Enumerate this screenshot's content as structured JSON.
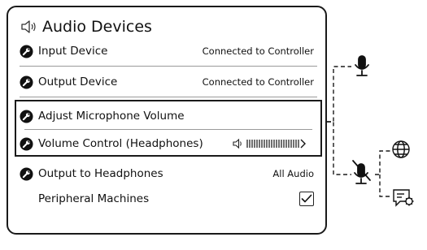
{
  "panel": {
    "title": "Audio Devices",
    "title_icon": "speaker-icon",
    "rows": [
      {
        "label": "Input Device",
        "value": "Connected to Controller",
        "icon": "wrench-icon"
      },
      {
        "label": "Output Device",
        "value": "Connected to Controller",
        "icon": "wrench-icon"
      },
      {
        "label": "Adjust Microphone Volume",
        "value": "",
        "icon": "wrench-icon"
      },
      {
        "label": "Volume Control (Headphones)",
        "value": "",
        "icon": "wrench-icon",
        "control": "volume-slider"
      },
      {
        "label": "Output to Headphones",
        "value": "All Audio",
        "icon": "wrench-icon"
      },
      {
        "label": "Peripheral Machines",
        "value": "",
        "checkbox_checked": true
      }
    ]
  },
  "side_icons": [
    "microphone-icon",
    "microphone-muted-icon",
    "globe-icon",
    "chat-settings-icon"
  ],
  "colors": {
    "stroke": "#1a1a1a",
    "separator": "#9a9a9a",
    "background": "#ffffff"
  }
}
